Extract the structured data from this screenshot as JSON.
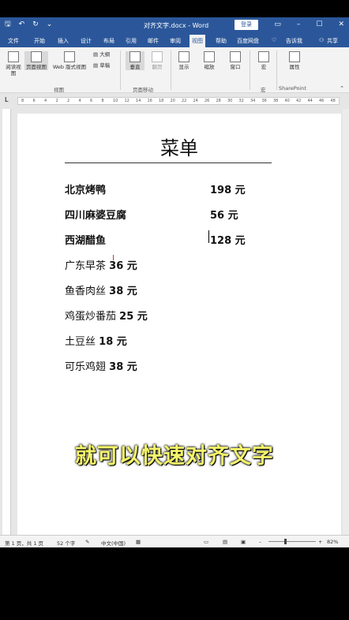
{
  "window": {
    "title": "对齐文字.docx - Word",
    "login_label": "登录"
  },
  "tabs": [
    "文件",
    "开始",
    "插入",
    "设计",
    "布局",
    "引用",
    "邮件",
    "审阅",
    "视图",
    "帮助",
    "百度网盘",
    "告诉我",
    "共享"
  ],
  "active_tab": "视图",
  "ribbon": {
    "read_view": "阅读视图",
    "print_layout": "页面视图",
    "web_layout": "Web 版式视图",
    "outline": "大纲",
    "draft": "草稿",
    "group_views": "视图",
    "vertical": "垂直",
    "side": "翻页",
    "group_page_move": "页面移动",
    "show": "显示",
    "zoom": "缩放",
    "window": "窗口",
    "macro": "宏",
    "group_macro": "宏",
    "properties": "属性",
    "group_sharepoint": "SharePoint"
  },
  "ruler_ticks": [
    "8",
    "6",
    "4",
    "2",
    "2",
    "4",
    "6",
    "8",
    "10",
    "12",
    "14",
    "16",
    "18",
    "20",
    "22",
    "24",
    "26",
    "28",
    "30",
    "32",
    "34",
    "36",
    "38",
    "40",
    "42",
    "44",
    "46",
    "48"
  ],
  "document": {
    "title": "菜单",
    "items": [
      {
        "name": "北京烤鸭",
        "price": "198 元"
      },
      {
        "name": "四川麻婆豆腐",
        "price": "56 元"
      },
      {
        "name": "西湖醋鱼",
        "price": "128 元"
      },
      {
        "name": "广东早茶",
        "price": "36 元"
      },
      {
        "name": "鱼香肉丝",
        "price": "38 元"
      },
      {
        "name": "鸡蛋炒番茄",
        "price": "25 元"
      },
      {
        "name": "土豆丝",
        "price": "18 元"
      },
      {
        "name": "可乐鸡翅",
        "price": "38 元"
      }
    ]
  },
  "caption": "就可以快速对齐文字",
  "statusbar": {
    "page": "第 1 页，共 1 页",
    "words": "52 个字",
    "language": "中文(中国)",
    "zoom": "82%"
  },
  "colors": {
    "titlebar": "#2b579a",
    "caption": "#f5f56a"
  }
}
